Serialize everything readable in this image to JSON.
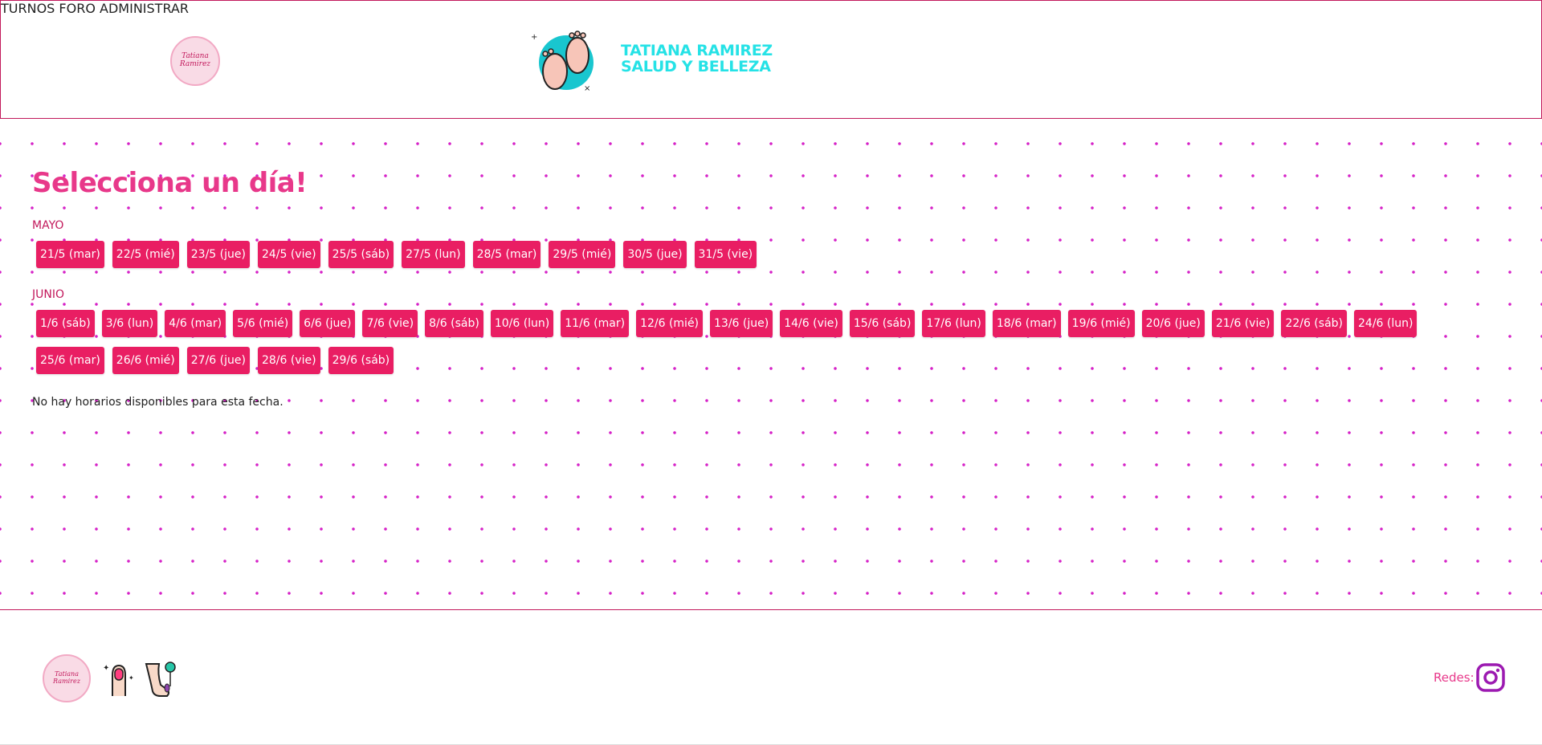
{
  "header": {
    "brand_line1": "TATIANA RAMIREZ",
    "brand_line2": "SALUD Y BELLEZA",
    "logo_script": "Tatiana Ramirez",
    "nav": [
      {
        "label": "TURNOS"
      },
      {
        "label": "FORO"
      },
      {
        "label": "ADMINISTRAR"
      }
    ]
  },
  "main": {
    "title": "Selecciona un día!",
    "months": [
      {
        "name": "MAYO",
        "rows": [
          [
            "21/5 (mar)",
            "22/5 (mié)",
            "23/5 (jue)",
            "24/5 (vie)",
            "25/5 (sáb)",
            "27/5 (lun)",
            "28/5 (mar)",
            "29/5 (mié)",
            "30/5 (jue)",
            "31/5 (vie)"
          ]
        ]
      },
      {
        "name": "JUNIO",
        "rows": [
          [
            "1/6 (sáb)",
            "3/6 (lun)",
            "4/6 (mar)",
            "5/6 (mié)",
            "6/6 (jue)",
            "7/6 (vie)",
            "8/6 (sáb)",
            "10/6 (lun)",
            "11/6 (mar)",
            "12/6 (mié)",
            "13/6 (jue)",
            "14/6 (vie)",
            "15/6 (sáb)",
            "17/6 (lun)",
            "18/6 (mar)",
            "19/6 (mié)",
            "20/6 (jue)",
            "21/6 (vie)",
            "22/6 (sáb)",
            "24/6 (lun)"
          ],
          [
            "25/6 (mar)",
            "26/6 (mié)",
            "27/6 (jue)",
            "28/6 (vie)",
            "29/6 (sáb)"
          ]
        ]
      }
    ],
    "message": "No hay horarios disponibles para esta fecha."
  },
  "footer": {
    "logo_script": "Tatiana Ramirez",
    "redes_label": "Redes:",
    "social_icon": "instagram-icon"
  },
  "colors": {
    "primary": "#e91e63",
    "accent_text": "#c2185b",
    "brand_cyan": "#25e2e6",
    "title_pink": "#e8388a",
    "dot_magenta": "#d622c7"
  }
}
